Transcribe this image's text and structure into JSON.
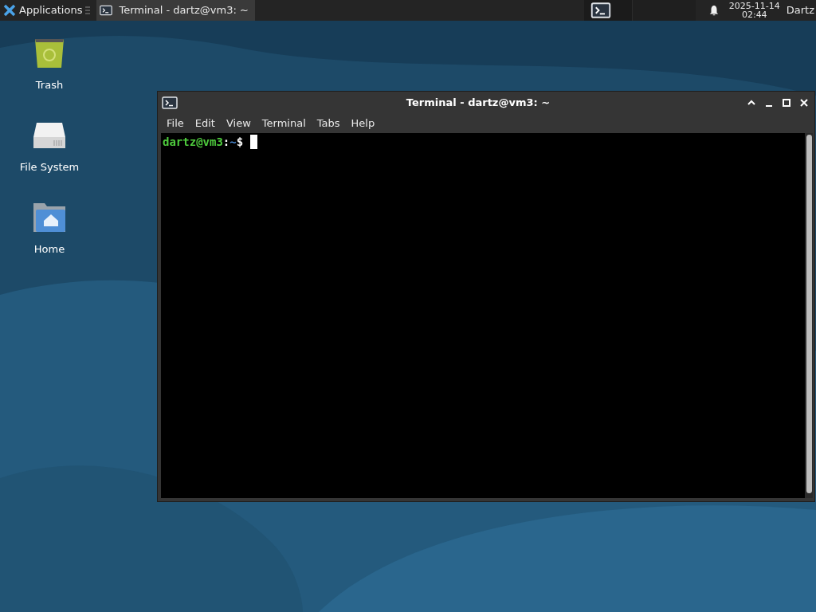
{
  "panel": {
    "applications": "Applications",
    "tasks": [
      {
        "label": "Terminal - dartz@vm3: ~",
        "selected": true
      }
    ],
    "clock_date": "2025-11-14",
    "clock_time": "02:44",
    "user": "Dartz"
  },
  "desktop_icons": [
    {
      "kind": "trash",
      "label": "Trash"
    },
    {
      "kind": "drive",
      "label": "File System"
    },
    {
      "kind": "home",
      "label": "Home"
    }
  ],
  "terminal": {
    "title": "Terminal - dartz@vm3: ~",
    "menu": [
      "File",
      "Edit",
      "View",
      "Terminal",
      "Tabs",
      "Help"
    ],
    "prompt": {
      "user_host": "dartz@vm3",
      "separator": ":",
      "path": "~",
      "symbol": "$"
    }
  }
}
